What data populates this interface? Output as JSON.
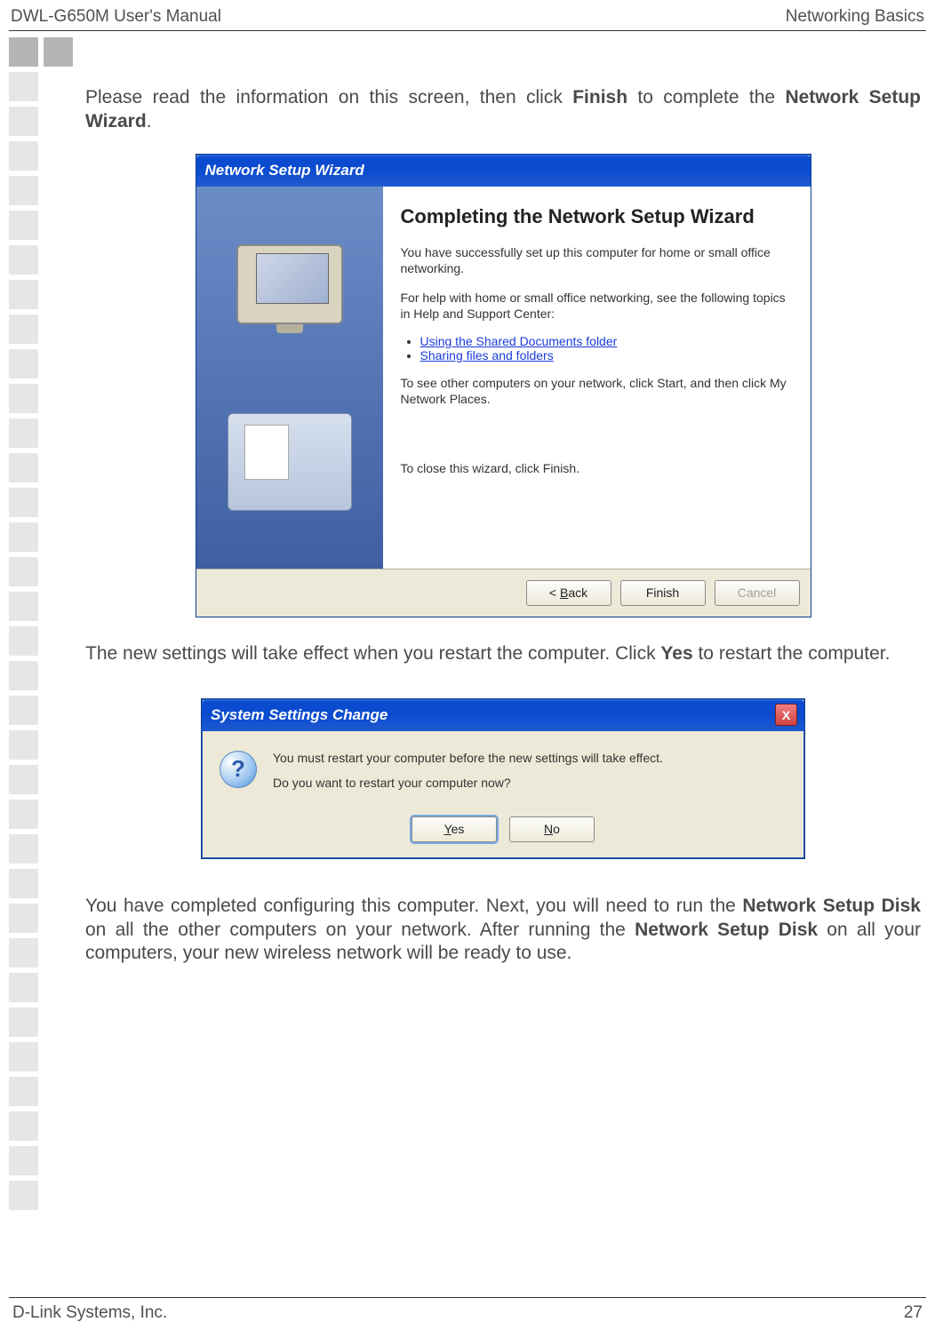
{
  "header": {
    "left": "DWL-G650M User's Manual",
    "right": "Networking Basics"
  },
  "para1": {
    "pre": "Please read the information on this screen, then click ",
    "b1": "Finish",
    "mid": " to complete the ",
    "b2": "Network Setup Wizard",
    "post": "."
  },
  "wizard": {
    "title": "Network Setup Wizard",
    "heading": "Completing the Network Setup Wizard",
    "p1": "You have successfully set up this computer for home or small office networking.",
    "p2": "For help with home or small office networking, see the following topics in Help and Support Center:",
    "link1": "Using the Shared Documents folder",
    "link2": "Sharing files and folders",
    "p3": "To see other computers on your network, click Start, and then click My Network Places.",
    "p4": "To close this wizard, click Finish.",
    "buttons": {
      "back_pre": "< ",
      "back_u": "B",
      "back_post": "ack",
      "finish": "Finish",
      "cancel": "Cancel"
    }
  },
  "para2": {
    "pre": "The new settings will take effect when you restart the computer. Click ",
    "b1": "Yes",
    "post": " to restart the computer."
  },
  "dialog": {
    "title": "System Settings Change",
    "p1": "You must restart your computer before the new settings will take effect.",
    "p2": "Do you want to restart your computer now?",
    "yes_u": "Y",
    "yes_post": "es",
    "no_u": "N",
    "no_post": "o",
    "close_x": "X",
    "q_mark": "?"
  },
  "para3": {
    "pre": "You have completed configuring this computer. Next, you will need to run the ",
    "b1": "Network Setup Disk",
    "mid": " on all the other computers on your network. After running the ",
    "b2": "Network Setup Disk",
    "post": " on all your computers, your new wireless network will be ready to use."
  },
  "footer": {
    "left": "D-Link Systems, Inc.",
    "page": "27"
  }
}
